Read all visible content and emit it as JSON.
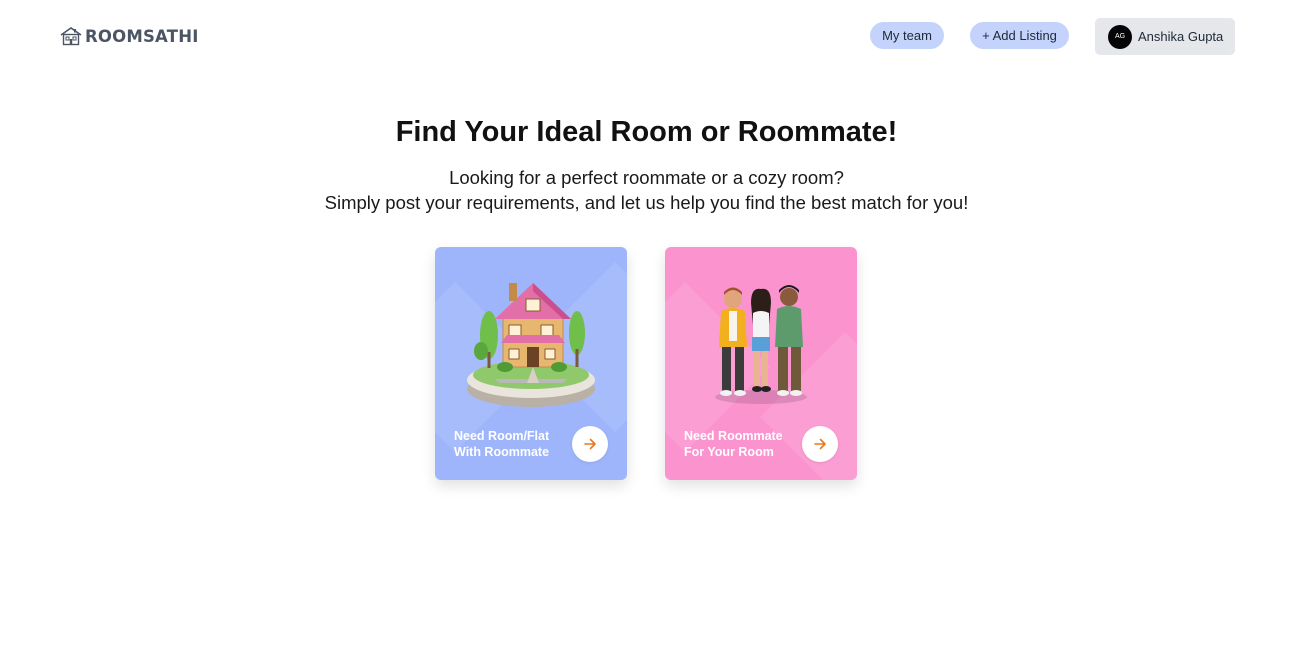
{
  "brand": {
    "name": "ROOMSATHI",
    "icon": "house-logo-icon"
  },
  "nav": {
    "team_label": "My team",
    "add_listing_label": "+ Add Listing",
    "user": {
      "initials": "AG",
      "name": "Anshika Gupta"
    }
  },
  "hero": {
    "title": "Find Your Ideal Room or Roommate!",
    "subtitle_line1": "Looking for a perfect roommate or a cozy room?",
    "subtitle_line2": "Simply post your requirements, and let us help you find the best match for you!"
  },
  "cards": [
    {
      "line1": "Need Room/Flat",
      "line2": "With Roommate",
      "illustration": "house-illustration",
      "color": "#9eb5fb",
      "action_icon": "arrow-right-icon"
    },
    {
      "line1": "Need Roommate",
      "line2": "For Your Room",
      "illustration": "people-illustration",
      "color": "#fb93cf",
      "action_icon": "arrow-right-icon"
    }
  ],
  "colors": {
    "pill_bg": "#c3d3fb",
    "user_chip_bg": "#e5e7eb",
    "arrow_color": "#e8781f",
    "logo_color": "#4b5563"
  }
}
